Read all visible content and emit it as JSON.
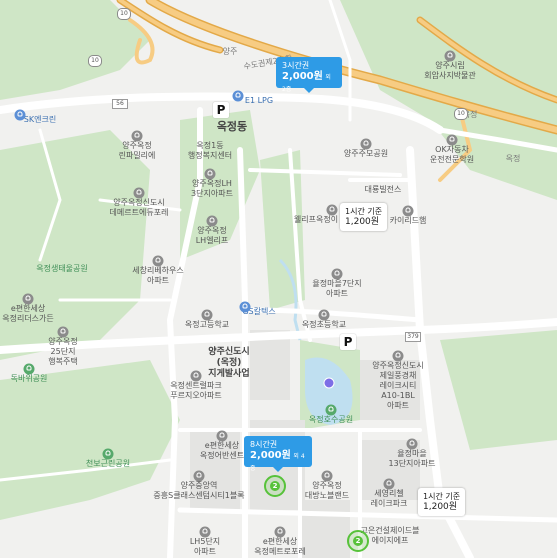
{
  "map": {
    "place_labels": [
      {
        "id": "okjeong-dong",
        "text": "옥정동",
        "class": "big"
      },
      {
        "id": "okjeong1-center",
        "text": "옥정1동\n행정복지센터"
      },
      {
        "id": "lynn-park",
        "text": "양주옥정\n린파밀리에"
      },
      {
        "id": "lh3",
        "text": "양주옥정LH\n3단지아파트"
      },
      {
        "id": "demeter",
        "text": "양주옥정신도시\n데메르트에듀포레"
      },
      {
        "id": "lh-ellipse",
        "text": "양주옥정\nLH엘리프"
      },
      {
        "id": "sechang",
        "text": "세창리베하우스\n아파트"
      },
      {
        "id": "okjeong-park",
        "text": "옥정생태울공원",
        "class": "green"
      },
      {
        "id": "e-pyunhan",
        "text": "e편한세상\n옥정리더스가든"
      },
      {
        "id": "lh25",
        "text": "양주옥정\n25단지\n행복주택"
      },
      {
        "id": "dokbawi",
        "text": "독바위공원",
        "class": "green"
      },
      {
        "id": "okjeong-high",
        "text": "옥정고등학교"
      },
      {
        "id": "gs",
        "text": "GS칼텍스",
        "class": "blue"
      },
      {
        "id": "okjeong-elem",
        "text": "옥정초등학교"
      },
      {
        "id": "yangju-newtown",
        "text": "양주신도시\n(옥정)\n지게발사업",
        "class": "big"
      },
      {
        "id": "feel-apt",
        "text": "옥정센트럴파크\n푸르지오아파트"
      },
      {
        "id": "cheonbo",
        "text": "천보근린공원",
        "class": "green"
      },
      {
        "id": "e-pyunhan2",
        "text": "e편한세상\n옥정어반센트"
      },
      {
        "id": "yangju-okjeong",
        "text": "양주중앙역\n중흥S클래스센텀시티1블록"
      },
      {
        "id": "lh5",
        "text": "LH5단지\n아파트"
      },
      {
        "id": "e-pyunhan3",
        "text": "e편한세상\n옥정메트로포레"
      },
      {
        "id": "okjeong-hosu",
        "text": "옥정호수공원",
        "class": "green"
      },
      {
        "id": "daebang",
        "text": "양주옥정\n대방노블랜드"
      },
      {
        "id": "sewol",
        "text": "세영리첼\n레이크파크"
      },
      {
        "id": "hanyang",
        "text": "양주옥정신도시\n제일풍경채\n레이크시티\nA10-1BL\n아파트"
      },
      {
        "id": "ok13",
        "text": "율정마을\n13단지아파트"
      },
      {
        "id": "goeun",
        "text": "고은건설제이드블\n에이지에프"
      },
      {
        "id": "ok7",
        "text": "율정마을7단지\n아파트"
      },
      {
        "id": "yangju-mart",
        "text": "양주주모공원"
      },
      {
        "id": "daebul",
        "text": "대룡빌전스"
      },
      {
        "id": "cellprime",
        "text": "웰리프옥정이"
      },
      {
        "id": "kaiaihome",
        "text": "카이리드햄"
      },
      {
        "id": "oaxha",
        "text": "OK자동차\n운전전문학원"
      },
      {
        "id": "yangju-hall",
        "text": "양주시립\n회암사지박물관"
      },
      {
        "id": "sk-energy",
        "text": "SK엔크린",
        "class": "blue"
      },
      {
        "id": "e1-lpg",
        "text": "E1 LPG",
        "class": "blue"
      },
      {
        "id": "okjeong-ic",
        "text": "옥정",
        "class": "road"
      },
      {
        "id": "okjeong-ic2",
        "text": "옥정",
        "class": "road"
      },
      {
        "id": "yangju-ic",
        "text": "양주",
        "class": "road"
      },
      {
        "id": "highway",
        "text": "수도권제2순환",
        "class": "road"
      }
    ],
    "road_shields": [
      {
        "id": "s10a",
        "text": "10"
      },
      {
        "id": "s10b",
        "text": "10"
      },
      {
        "id": "s10c",
        "text": "10"
      },
      {
        "id": "s56",
        "text": "56"
      },
      {
        "id": "s379",
        "text": "379"
      }
    ],
    "parking_pins": [
      {
        "id": "p1",
        "text": "P"
      },
      {
        "id": "p2",
        "text": "P"
      }
    ],
    "price_tags": [
      {
        "id": "tag-3h",
        "style": "blue",
        "line1": "3시간권",
        "price": "2,000원",
        "note": "외 2종"
      },
      {
        "id": "tag-8h",
        "style": "blue",
        "line1": "8시간권",
        "price": "2,000원",
        "note": "외 4종"
      },
      {
        "id": "tag-1h-a",
        "style": "white",
        "line1": "1시간 기준",
        "price": "1,200원"
      },
      {
        "id": "tag-1h-b",
        "style": "white",
        "line1": "1시간 기준",
        "price": "1,200원"
      }
    ],
    "clusters": [
      {
        "id": "c1",
        "count": "2"
      },
      {
        "id": "c2",
        "count": "2"
      }
    ],
    "colors": {
      "land": "#f1f1ef",
      "green": "#cfe6c6",
      "water": "#bfdff0",
      "road": "#ffffff",
      "highway": "#f7cc83",
      "accent": "#2e9be6",
      "cluster": "#57c23a"
    }
  }
}
